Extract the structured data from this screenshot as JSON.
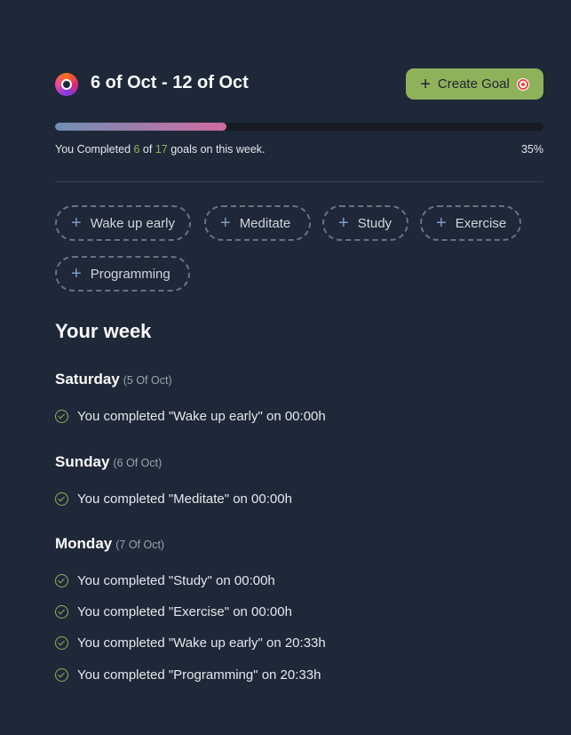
{
  "header": {
    "range_title": "6 of Oct - 12 of Oct",
    "create_goal_label": "Create Goal",
    "create_goal_plus": "+"
  },
  "progress": {
    "completed": "6",
    "total": "17",
    "percent_label": "35%",
    "fraction": 0.35,
    "text_prefix": "You Completed ",
    "text_middle": " of ",
    "text_suffix": " goals on this week."
  },
  "goals": [
    {
      "label": "Wake up early"
    },
    {
      "label": "Meditate"
    },
    {
      "label": "Study"
    },
    {
      "label": "Exercise"
    },
    {
      "label": "Programming"
    }
  ],
  "week": {
    "title": "Your week",
    "days": [
      {
        "name": "Saturday",
        "date": "(5 Of Oct)",
        "entries": [
          "You completed \"Wake up early\" on 00:00h"
        ]
      },
      {
        "name": "Sunday",
        "date": "(6 Of Oct)",
        "entries": [
          "You completed \"Meditate\" on 00:00h"
        ]
      },
      {
        "name": "Monday",
        "date": "(7 Of Oct)",
        "entries": [
          "You completed \"Study\" on 00:00h",
          "You completed \"Exercise\" on 00:00h",
          "You completed \"Wake up early\" on 20:33h",
          "You completed \"Programming\" on 20:33h"
        ]
      }
    ]
  },
  "colors": {
    "background": "#1e2838",
    "accent_green": "#8fb15a",
    "progress_start": "#6f8fb3",
    "progress_end": "#d06aa2"
  },
  "icons": {
    "logo": "inorbit-logo-icon",
    "create": "plus-icon",
    "target": "target-icon",
    "check": "check-circle-icon"
  }
}
